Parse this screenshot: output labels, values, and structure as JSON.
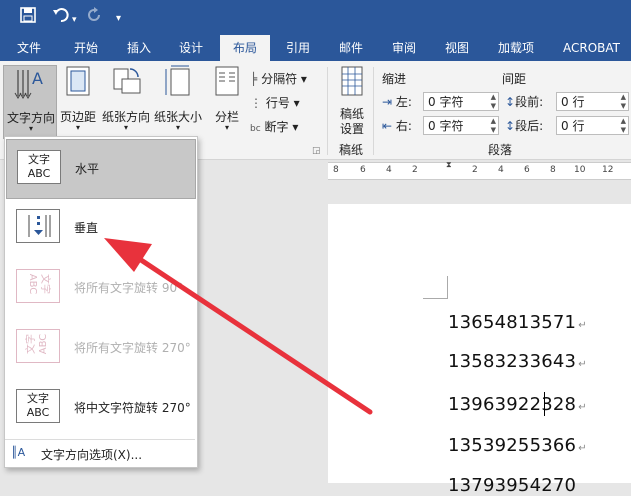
{
  "quick_access": {
    "save_icon": "save-icon",
    "undo_icon": "undo-icon",
    "redo_icon": "redo-icon",
    "customize_icon": "customize-icon"
  },
  "tabs": [
    {
      "label": "文件"
    },
    {
      "label": "开始"
    },
    {
      "label": "插入"
    },
    {
      "label": "设计"
    },
    {
      "label": "布局",
      "active": true
    },
    {
      "label": "引用"
    },
    {
      "label": "邮件"
    },
    {
      "label": "审阅"
    },
    {
      "label": "视图"
    },
    {
      "label": "加载项"
    },
    {
      "label": "ACROBAT"
    }
  ],
  "ribbon": {
    "text_direction": "文字方向",
    "margins": "页边距",
    "orientation": "纸张方向",
    "size": "纸张大小",
    "columns": "分栏",
    "breaks": "分隔符",
    "line_numbers": "行号",
    "hyphenation": "断字",
    "manuscript_setup": "稿纸\n设置",
    "manuscript_group": "稿纸",
    "indent_label": "缩进",
    "spacing_label": "间距",
    "indent_left_label": "左:",
    "indent_left_value": "0 字符",
    "indent_right_label": "右:",
    "indent_right_value": "0 字符",
    "space_before_label": "段前:",
    "space_before_value": "0 行",
    "space_after_label": "段后:",
    "space_after_value": "0 行",
    "paragraph_group": "段落"
  },
  "ruler": [
    "8",
    "6",
    "4",
    "2",
    "2",
    "4",
    "6",
    "8",
    "10",
    "12"
  ],
  "dropdown": {
    "options": [
      {
        "label": "水平",
        "thumb": "文字\nABC",
        "enabled": true,
        "selected": true
      },
      {
        "label": "垂直",
        "thumb": "vertical",
        "enabled": true
      },
      {
        "label": "将所有文字旋转 90°",
        "thumb": "文字\nABC",
        "enabled": false
      },
      {
        "label": "将所有文字旋转 270°",
        "thumb": "文字\nABC",
        "enabled": false
      },
      {
        "label": "将中文字符旋转 270°",
        "thumb": "文字\nABC",
        "enabled": true
      }
    ],
    "footer": "文字方向选项(X)..."
  },
  "document": {
    "numbers": [
      "13654813571",
      "13583233643",
      "13963922328",
      "13539255366",
      "13793954270"
    ]
  },
  "colors": {
    "ribbon_blue": "#2b579a",
    "arrow_red": "#e8323c"
  }
}
